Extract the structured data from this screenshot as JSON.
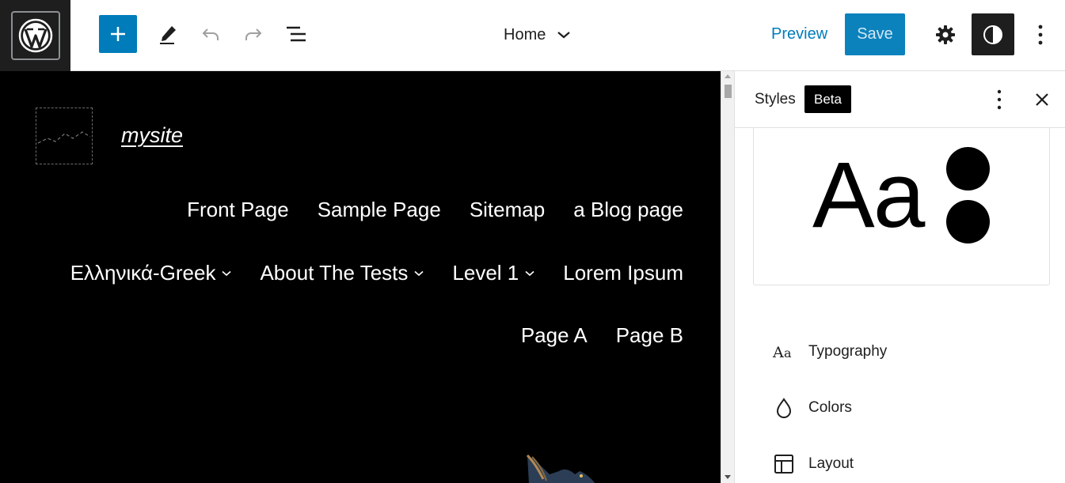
{
  "toolbar": {
    "document_title": "Home",
    "preview_label": "Preview",
    "save_label": "Save"
  },
  "canvas": {
    "site_title": "mysite",
    "nav_row1": [
      "Front Page",
      "Sample Page",
      "Sitemap",
      "a Blog page"
    ],
    "nav_row2": [
      {
        "label": "Ελληνικά-Greek",
        "has_submenu": true
      },
      {
        "label": "About The Tests",
        "has_submenu": true
      },
      {
        "label": "Level 1",
        "has_submenu": true
      },
      {
        "label": "Lorem Ipsum",
        "has_submenu": false
      }
    ],
    "nav_row3": [
      "Page A",
      "Page B"
    ]
  },
  "sidebar": {
    "title": "Styles",
    "badge": "Beta",
    "preview_text": "Aa",
    "items": [
      {
        "label": "Typography",
        "icon": "typography-icon"
      },
      {
        "label": "Colors",
        "icon": "droplet-icon"
      },
      {
        "label": "Layout",
        "icon": "layout-icon"
      }
    ]
  },
  "colors": {
    "accent": "#007cba",
    "dark": "#1e1e1e",
    "canvas_bg": "#000000"
  }
}
